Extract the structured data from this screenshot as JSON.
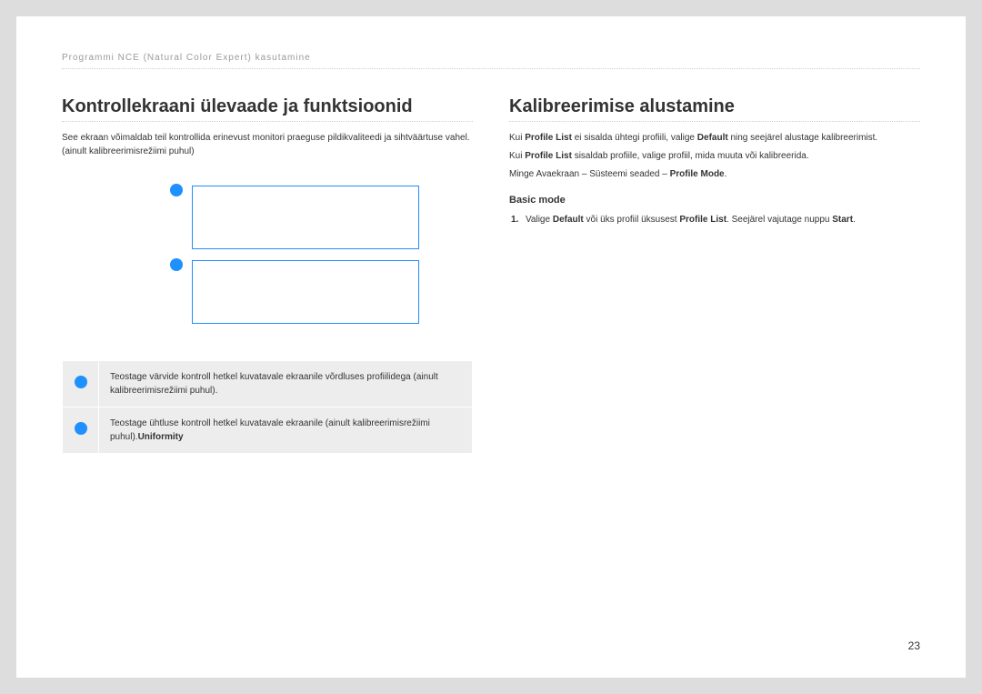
{
  "header": "Programmi NCE (Natural Color Expert) kasutamine",
  "left": {
    "title": "Kontrollekraani ülevaade ja funktsioonid",
    "intro": "See ekraan võimaldab teil kontrollida erinevust monitori praeguse pildikvaliteedi ja sihtväärtuse vahel. (ainult kalibreerimisrežiimi puhul)",
    "legend": {
      "row1": "Teostage värvide kontroll hetkel kuvatavale ekraanile võrdluses profiilidega (ainult kalibreerimisrežiimi puhul).",
      "row2_pre": "Teostage ühtluse kontroll hetkel kuvatavale ekraanile (ainult kalibreerimisrežiimi puhul).",
      "row2_bold": "Uniformity"
    }
  },
  "right": {
    "title": "Kalibreerimise alustamine",
    "p1_a": "Kui ",
    "p1_b": "Profile List",
    "p1_c": " ei sisalda ühtegi profiili, valige ",
    "p1_d": "Default",
    "p1_e": " ning seejärel alustage kalibreerimist.",
    "p2_a": "Kui ",
    "p2_b": "Profile List",
    "p2_c": " sisaldab profiile, valige profiil, mida muuta või kalibreerida.",
    "p3_a": "Minge Avaekraan – Süsteemi seaded – ",
    "p3_b": "Profile Mode",
    "p3_c": ".",
    "subhead": "Basic mode",
    "li_num": "1.",
    "li_a": "Valige ",
    "li_b": "Default",
    "li_c": " või üks profiil üksusest ",
    "li_d": "Profile List",
    "li_e": ". Seejärel vajutage nuppu ",
    "li_f": "Start",
    "li_g": "."
  },
  "pagenum": "23"
}
